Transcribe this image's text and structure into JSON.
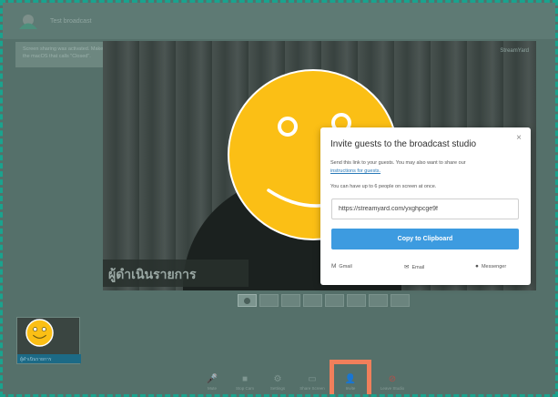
{
  "app": {
    "title": "Test broadcast"
  },
  "notice": {
    "text": "Screen sharing was activated. Make sure you click \"Share\" on",
    "text2": "the macOS that calls \"Closed\"."
  },
  "stage": {
    "lower_third": "ผู้ดำเนินรายการ",
    "corner_text": "StreamYard"
  },
  "guest": {
    "name": "ผู้ดำเนินรายการ"
  },
  "controls": [
    {
      "label": "Mute",
      "glyph": "🎤"
    },
    {
      "label": "Stop Cam",
      "glyph": "■"
    },
    {
      "label": "Settings",
      "glyph": "⚙"
    },
    {
      "label": "Share Screen",
      "glyph": "▭"
    },
    {
      "label": "Invite",
      "glyph": "👤"
    },
    {
      "label": "Leave Studio",
      "glyph": "⊘"
    }
  ],
  "dialog": {
    "title": "Invite guests to the broadcast studio",
    "close": "×",
    "desc": "Send this link to your guests. You may also want to share our",
    "desc_link": "instructions for guests.",
    "limit": "You can have up to 6 people on screen at once.",
    "link_value": "https://streamyard.com/yxghpcge9f",
    "copy_label": "Copy to Clipboard",
    "share": [
      {
        "label": "Gmail",
        "icon": "M"
      },
      {
        "label": "Email",
        "icon": "✉"
      },
      {
        "label": "Messenger",
        "icon": "●"
      }
    ]
  },
  "colors": {
    "accent": "#3d9be0",
    "smiley": "#fbbf15",
    "highlight": "#f07f5b",
    "frame": "#1aa38e"
  }
}
